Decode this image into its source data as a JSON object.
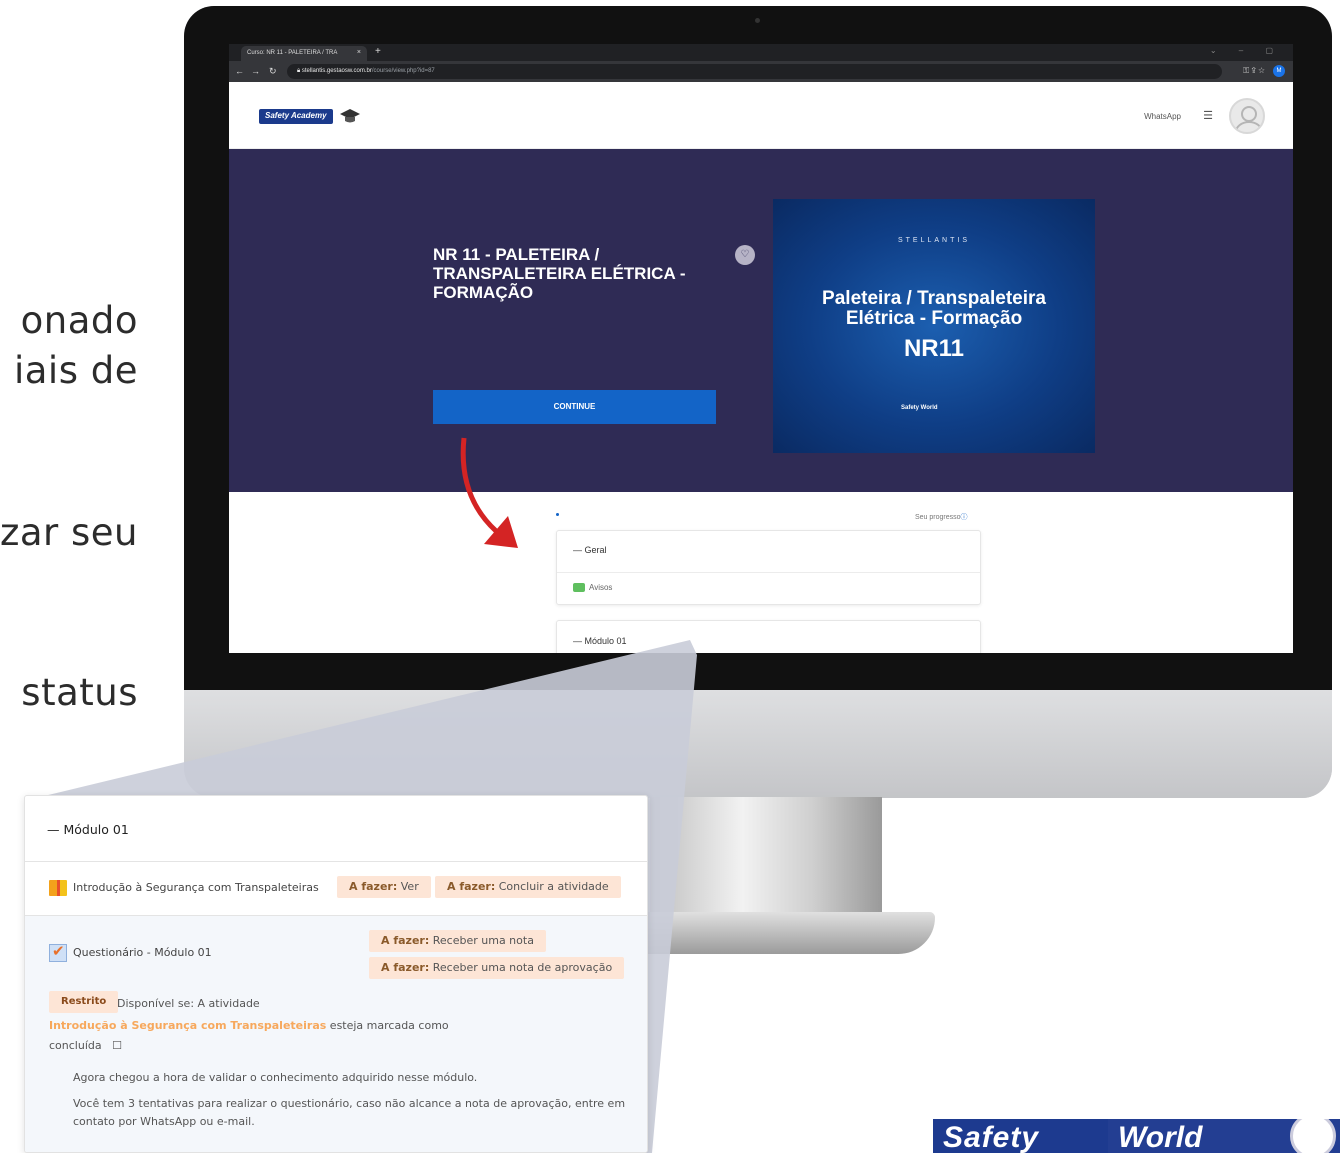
{
  "side_text": [
    "onado",
    "iais de",
    "zar seu",
    "status"
  ],
  "browser": {
    "tab_title": "Curso: NR 11 - PALETEIRA / TRA",
    "tab_close": "×",
    "new_tab": "+",
    "url_host": "stellantis.gestaosw.com.br",
    "url_path": "/course/view.php?id=87",
    "profile_initial": "M",
    "icons": [
      "back-icon",
      "forward-icon",
      "reload-icon",
      "lock-icon",
      "key-icon",
      "share-icon",
      "star-icon"
    ]
  },
  "site": {
    "logo_text": "Safety Academy",
    "nav_whatsapp": "WhatsApp",
    "menu_icon": "☰",
    "course_title": "NR 11 - PALETEIRA / TRANSPALETEIRA ELÉTRICA - FORMAÇÃO",
    "continue_label": "CONTINUE",
    "course_image": {
      "brand": "STELLANTIS",
      "line1": "Paleteira / Transpaleteira",
      "line2": "Elétrica - Formação",
      "nr": "NR11",
      "logo": "Safety World"
    },
    "progress_label": "Seu progresso",
    "sections": [
      {
        "title": "Geral",
        "items": [
          "Avisos"
        ]
      },
      {
        "title": "Módulo 01"
      }
    ]
  },
  "zoom": {
    "section_title": "Módulo 01",
    "activity1": {
      "name": "Introdução à Segurança com Transpaleteiras",
      "badges": [
        {
          "label": "A fazer:",
          "value": "Ver"
        },
        {
          "label": "A fazer:",
          "value": "Concluir a atividade"
        }
      ]
    },
    "activity2": {
      "name": "Questionário - Módulo 01",
      "badges": [
        {
          "label": "A fazer:",
          "value": "Receber uma nota"
        },
        {
          "label": "A fazer:",
          "value": "Receber uma nota de aprovação"
        }
      ]
    },
    "restriction": {
      "badge": "Restrito",
      "text1": "Disponível se: A atividade",
      "link": "Introdução à Segurança com Transpaleteiras",
      "text2": "esteja marcada como",
      "text3": "concluída",
      "checkbox": "☐"
    },
    "description": {
      "line1": "Agora chegou a hora de validar o conhecimento adquirido nesse módulo.",
      "line2": "Você tem 3 tentativas para realizar o questionário, caso não alcance a nota de aprovação, entre em",
      "line3": "contato por WhatsApp ou e-mail."
    }
  },
  "footer_brand": {
    "word1": "Safety",
    "word2": "World"
  },
  "colors": {
    "hero": "#2f2b55",
    "button": "#1364c7",
    "badge": "#fde5d6",
    "link_orange": "#f7a85c",
    "arrow_red": "#d42424"
  }
}
